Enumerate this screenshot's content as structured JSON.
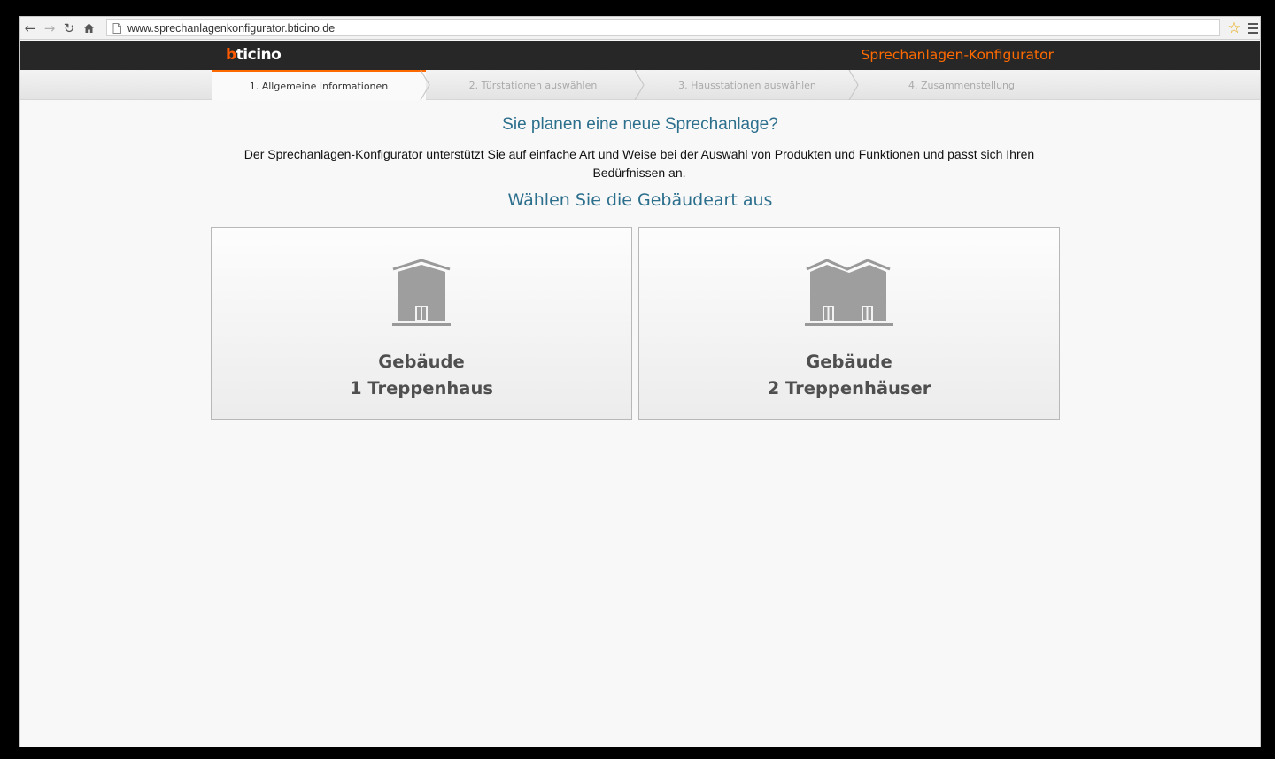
{
  "browser": {
    "url": "www.sprechanlagenkonfigurator.bticino.de",
    "icons": [
      "back-icon",
      "forward-icon",
      "reload-icon",
      "home-icon",
      "page-icon",
      "bookmark-star-icon",
      "menu-icon"
    ]
  },
  "header": {
    "logo": "bticino",
    "title": "Sprechanlagen-Konfigurator",
    "accent_color": "#ff6a00"
  },
  "steps": [
    {
      "label": "1. Allgemeine Informationen",
      "active": true
    },
    {
      "label": "2. Türstationen auswählen",
      "active": false
    },
    {
      "label": "3. Hausstationen auswählen",
      "active": false
    },
    {
      "label": "4. Zusammenstellung",
      "active": false
    }
  ],
  "main": {
    "headline": "Sie planen eine neue Sprechanlage?",
    "intro": "Der Sprechanlagen-Konfigurator unterstützt Sie auf einfache Art und Weise bei der Auswahl von Produkten und Funktionen und passt sich Ihren Bedürfnissen an.",
    "subheadline": "Wählen Sie die Gebäudeart aus",
    "cards": [
      {
        "line1": "Gebäude",
        "line2": "1 Treppenhaus",
        "icon": "single-building-icon"
      },
      {
        "line1": "Gebäude",
        "line2": "2 Treppenhäuser",
        "icon": "double-building-icon"
      }
    ]
  }
}
